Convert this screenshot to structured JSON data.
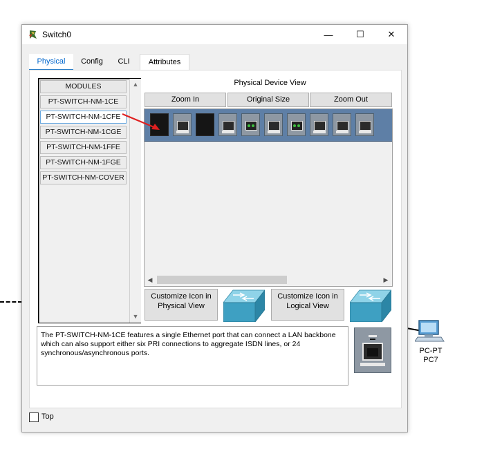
{
  "window": {
    "title": "Switch0",
    "minimize_glyph": "—",
    "maximize_glyph": "☐",
    "close_glyph": "✕"
  },
  "tabs": [
    {
      "label": "Physical",
      "active": true
    },
    {
      "label": "Config",
      "active": false
    },
    {
      "label": "CLI",
      "active": false
    },
    {
      "label": "Attributes",
      "active": false
    }
  ],
  "modules": {
    "header": "MODULES",
    "items": [
      {
        "label": "PT-SWITCH-NM-1CE",
        "selected": false
      },
      {
        "label": "PT-SWITCH-NM-1CFE",
        "selected": true
      },
      {
        "label": "PT-SWITCH-NM-1CGE",
        "selected": false
      },
      {
        "label": "PT-SWITCH-NM-1FFE",
        "selected": false
      },
      {
        "label": "PT-SWITCH-NM-1FGE",
        "selected": false
      },
      {
        "label": "PT-SWITCH-NM-COVER",
        "selected": false
      }
    ]
  },
  "physical_view": {
    "title": "Physical Device View",
    "zoom_in": "Zoom In",
    "original_size": "Original Size",
    "zoom_out": "Zoom Out",
    "customize_physical": "Customize Icon in Physical View",
    "customize_logical": "Customize Icon in Logical View"
  },
  "description": "The PT-SWITCH-NM-1CE features a single Ethernet port that can connect a LAN backbone which can also support either six PRI connections to aggregate ISDN lines, or 24 synchronous/asynchronous ports.",
  "footer": {
    "top_label": "Top",
    "top_checked": false
  },
  "workspace": {
    "pc_type": "PC-PT",
    "pc_name": "PC7"
  },
  "colors": {
    "tab_active": "#0066cc",
    "device_chassis": "#5e7fa6",
    "annotation_arrow": "#e02020"
  }
}
